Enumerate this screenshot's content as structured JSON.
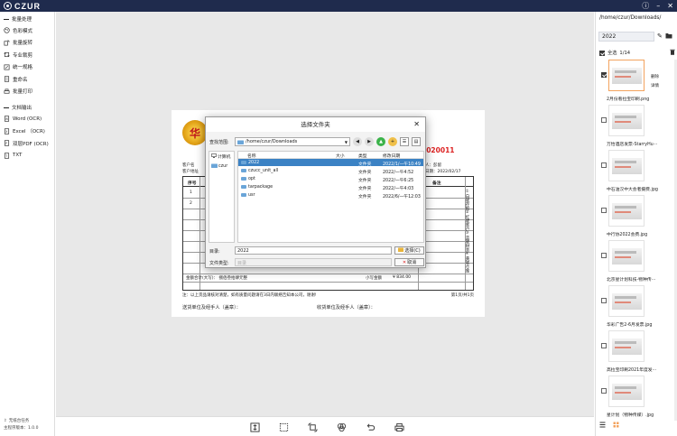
{
  "app": {
    "brand": "CZUR"
  },
  "sidebar": {
    "sections": [
      {
        "title": "批量处理",
        "items": [
          "色彩模式",
          "批量旋转",
          "专业裁剪",
          "统一规格",
          "重命名",
          "批量打印"
        ]
      },
      {
        "title": "文档输出",
        "items": [
          "Word (OCR)",
          "Excel （OCR)",
          "双层PDF (OCR)",
          "TXT"
        ]
      }
    ],
    "bottom_link": "无纸台任务",
    "version": "主程序版本：1.0.0"
  },
  "document": {
    "seal_text": "华",
    "doc_number": "2020011",
    "meta_left1": "客户名",
    "meta_left2": "客户地址",
    "meta_right1": "人：彭留",
    "meta_right2": "日期：2022/02/17",
    "table_head_no": "序号",
    "table_head_note": "备注",
    "row1": "1",
    "row2": "2",
    "side_col": "①白联存根②红联客户③蓝联财务④黄联仓库",
    "total_label": "金额合计(大写)： 捌佰叁拾肆元整",
    "total_small_label": "小写金额",
    "total_small_value": "¥ 834.00",
    "footnote": "注：以上货品请核对清楚，如有质量问题请在3日内联络告知本公司，谢谢!",
    "page": "第1页/共1页",
    "sign_left": "送货单位及经手人（盖章）：",
    "sign_right": "收货单位及经手人（盖章）："
  },
  "dialog": {
    "title": "选择文件夹",
    "lookin_label": "查找范围:",
    "lookin_value": "/home/czur/Downloads",
    "places": [
      "计算机",
      "czur"
    ],
    "headers": {
      "name": "名称",
      "size": "大小",
      "type": "类型",
      "date": "修改日期"
    },
    "files": [
      {
        "name": "2022",
        "type": "文件夹",
        "date": "2022/1/一午10:49"
      },
      {
        "name": "czucc_unit_all",
        "type": "文件夹",
        "date": "2022/一午4:52"
      },
      {
        "name": "opt",
        "type": "文件夹",
        "date": "2022/一午6:25"
      },
      {
        "name": "tarpackage",
        "type": "文件夹",
        "date": "2022/一午4:03"
      },
      {
        "name": "usr",
        "type": "文件夹",
        "date": "2022/6/一午12:03"
      }
    ],
    "dir_label": "目录:",
    "dir_value": "2022",
    "type_label": "文件类型:",
    "type_value": "目录",
    "choose_button": "选择(C)",
    "cancel_button": "取消"
  },
  "rpanel": {
    "path": "/home/czur/Downloads/",
    "folder": "2022",
    "select_all": "全选",
    "count": "1/14",
    "thumb_actions": [
      "删除",
      "详情"
    ],
    "thumbs": [
      "2月份看拉宝印刷.png",
      "万怡酒店发票-StarryHu···",
      "中石油汉中大会者摄费.jpg",
      "中行协2022会费.jpg",
      "北京星计划科技-物种传···",
      "华彩广告2-6月发票.jpg",
      "高拉宝印刷2021年度发···",
      "星计划（物种传媒）.jpg"
    ]
  },
  "colors": {
    "titlebar": "#1f2b4d",
    "selection": "#3b82c4",
    "accent": "#f3a35e",
    "doc_number": "#dd2222"
  }
}
